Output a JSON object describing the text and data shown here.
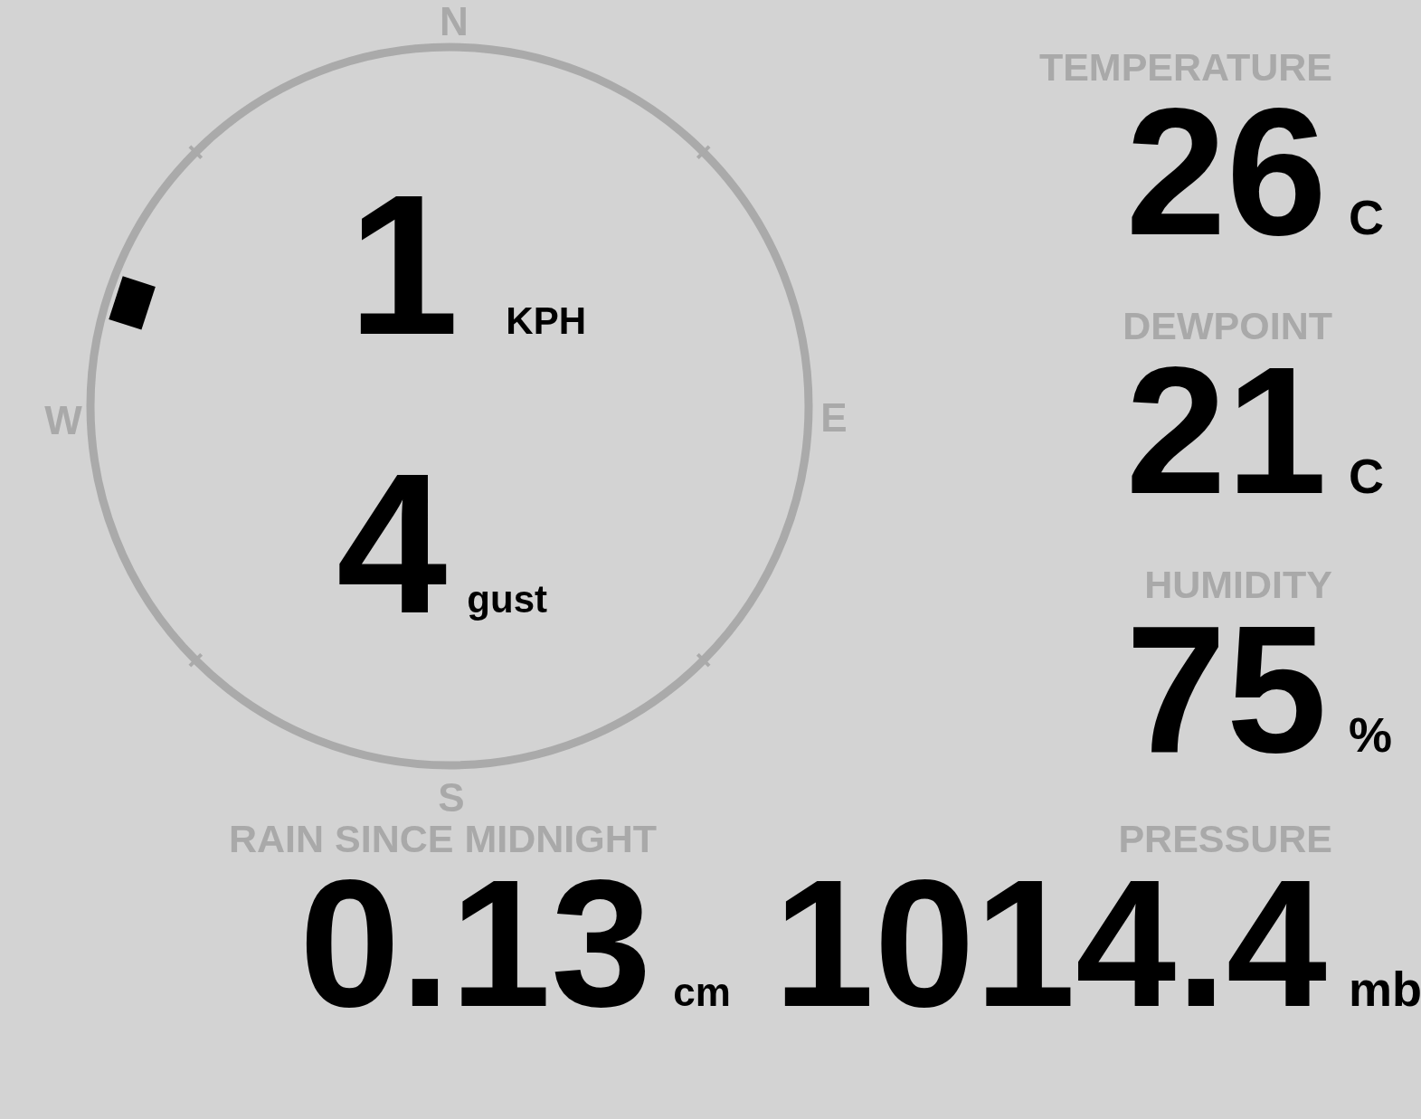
{
  "wind": {
    "compass_labels": [
      "N",
      "E",
      "S",
      "W"
    ],
    "speed": {
      "value": "1",
      "unit": "KPH"
    },
    "gust": {
      "value": "4",
      "unit": "gust"
    }
  },
  "stats": [
    {
      "label": "TEMPERATURE",
      "value": "26",
      "unit": "C"
    },
    {
      "label": "DEWPOINT",
      "value": "21",
      "unit": "C"
    },
    {
      "label": "HUMIDITY",
      "value": "75",
      "unit": "%"
    }
  ],
  "rain": {
    "label": "RAIN SINCE MIDNIGHT",
    "value": "0.13",
    "unit": "cm"
  },
  "pressure": {
    "label": "PRESSURE",
    "value": "1014.4",
    "unit": "mb"
  }
}
